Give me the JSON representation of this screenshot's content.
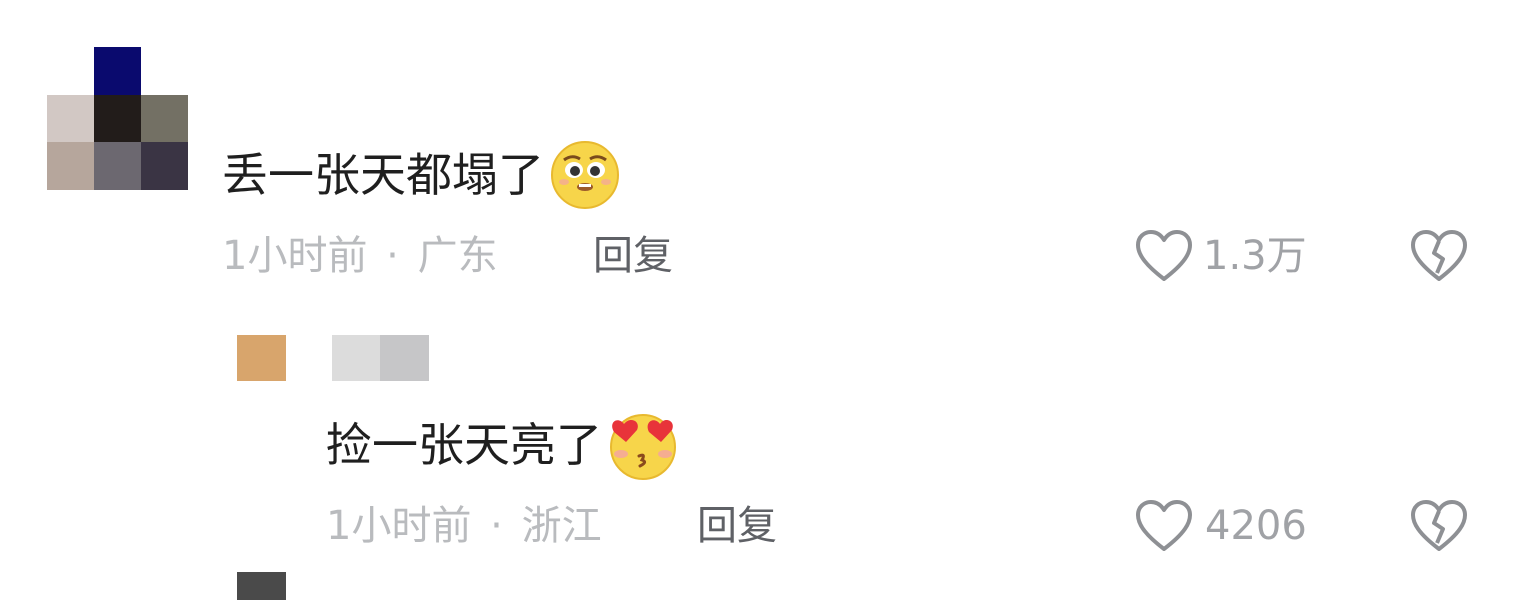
{
  "comments": [
    {
      "text": "丢一张天都塌了",
      "emoji": "pleading-face-emoji",
      "time": "1小时前",
      "separator": "·",
      "location": "广东",
      "reply_label": "回复",
      "like_count": "1.3万"
    }
  ],
  "reply": {
    "text": "捡一张天亮了",
    "emoji": "heart-eyes-kiss-emoji",
    "time": "1小时前",
    "separator": "·",
    "location": "浙江",
    "reply_label": "回复",
    "like_count": "4206"
  },
  "colors": {
    "text": "#1f1f1f",
    "meta": "#b9bbbe",
    "reply_button": "#5f6166",
    "icon": "#8e9094"
  }
}
